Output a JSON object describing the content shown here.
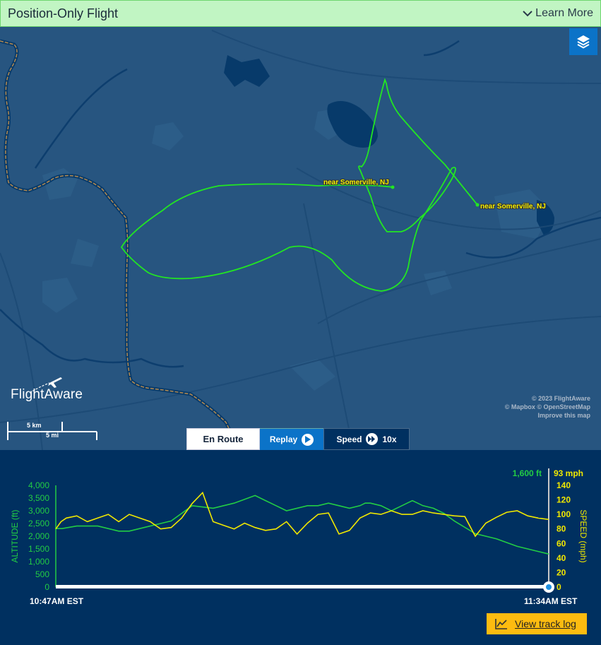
{
  "header": {
    "title": "Position-Only Flight",
    "learn_more": "Learn More",
    "learn_more_icon": "chevron-down-icon"
  },
  "map": {
    "layers_icon": "layers-icon",
    "origin_label": "near Somerville, NJ",
    "destination_label": "near Somerville, NJ",
    "track_color": "#22e622",
    "logo_text": "FlightAware",
    "scale_km": "5 km",
    "scale_mi": "5 mi",
    "attribution": [
      "© 2023 FlightAware",
      "© Mapbox © OpenStreetMap",
      "Improve this map"
    ]
  },
  "tabs": {
    "en_route": "En Route",
    "replay": "Replay",
    "speed": "Speed",
    "speed_value": "10x"
  },
  "chart_data": {
    "type": "line",
    "x_start_label": "10:47AM EST",
    "x_end_label": "11:34AM EST",
    "current_altitude": "1,600 ft",
    "current_speed": "93 mph",
    "left_axis": {
      "label": "ALTITUDE (ft)",
      "ticks": [
        "4,000",
        "3,500",
        "3,000",
        "2,500",
        "2,000",
        "1,500",
        "1,000",
        "500",
        "0"
      ],
      "range": [
        0,
        4000
      ],
      "color": "#22cc44"
    },
    "right_axis": {
      "label": "SPEED (mph)",
      "ticks": [
        "140",
        "120",
        "100",
        "80",
        "60",
        "40",
        "20",
        "0"
      ],
      "range": [
        0,
        140
      ],
      "color": "#f0e800"
    },
    "x_range_minutes": [
      0,
      47
    ],
    "series": [
      {
        "name": "Altitude",
        "color": "#22cc44",
        "x": [
          0,
          0.6,
          2,
          4,
          6,
          7,
          8,
          10,
          11,
          13,
          15,
          17,
          19,
          20,
          21,
          21.5,
          22,
          24,
          25,
          26,
          27,
          28,
          29,
          29.5,
          30,
          31,
          32,
          33,
          33.5,
          34,
          34.5,
          35,
          36,
          37,
          38,
          40,
          42,
          44,
          45,
          46,
          47
        ],
        "values": [
          2300,
          2300,
          2400,
          2400,
          2200,
          2200,
          2300,
          2500,
          2600,
          3200,
          3100,
          3300,
          3600,
          3400,
          3200,
          3100,
          3000,
          3200,
          3200,
          3300,
          3200,
          3100,
          3200,
          3300,
          3300,
          3200,
          3000,
          3200,
          3300,
          3400,
          3300,
          3200,
          3100,
          2900,
          2600,
          2100,
          1900,
          1600,
          1500,
          1400,
          1300
        ]
      },
      {
        "name": "Speed",
        "color": "#f0e800",
        "x": [
          0,
          0.5,
          1,
          2,
          3,
          4,
          5,
          6,
          7,
          8,
          9,
          9.5,
          10,
          11,
          12,
          13,
          14,
          14.5,
          15,
          16,
          17,
          18,
          19,
          20,
          21,
          22,
          23,
          24,
          25,
          26,
          27,
          28,
          29,
          30,
          31,
          32,
          33,
          34,
          35,
          36,
          37,
          38,
          39,
          40,
          41,
          42,
          43,
          44,
          45,
          46,
          47
        ],
        "values": [
          80,
          90,
          95,
          98,
          90,
          95,
          100,
          90,
          100,
          95,
          90,
          85,
          80,
          82,
          95,
          115,
          130,
          110,
          90,
          85,
          80,
          88,
          82,
          78,
          80,
          90,
          73,
          88,
          100,
          102,
          73,
          78,
          95,
          102,
          100,
          105,
          100,
          100,
          105,
          102,
          100,
          98,
          97,
          70,
          88,
          96,
          103,
          105,
          98,
          95,
          93
        ]
      }
    ]
  },
  "track_log": {
    "label": "View track log",
    "icon": "chart-line-icon"
  }
}
